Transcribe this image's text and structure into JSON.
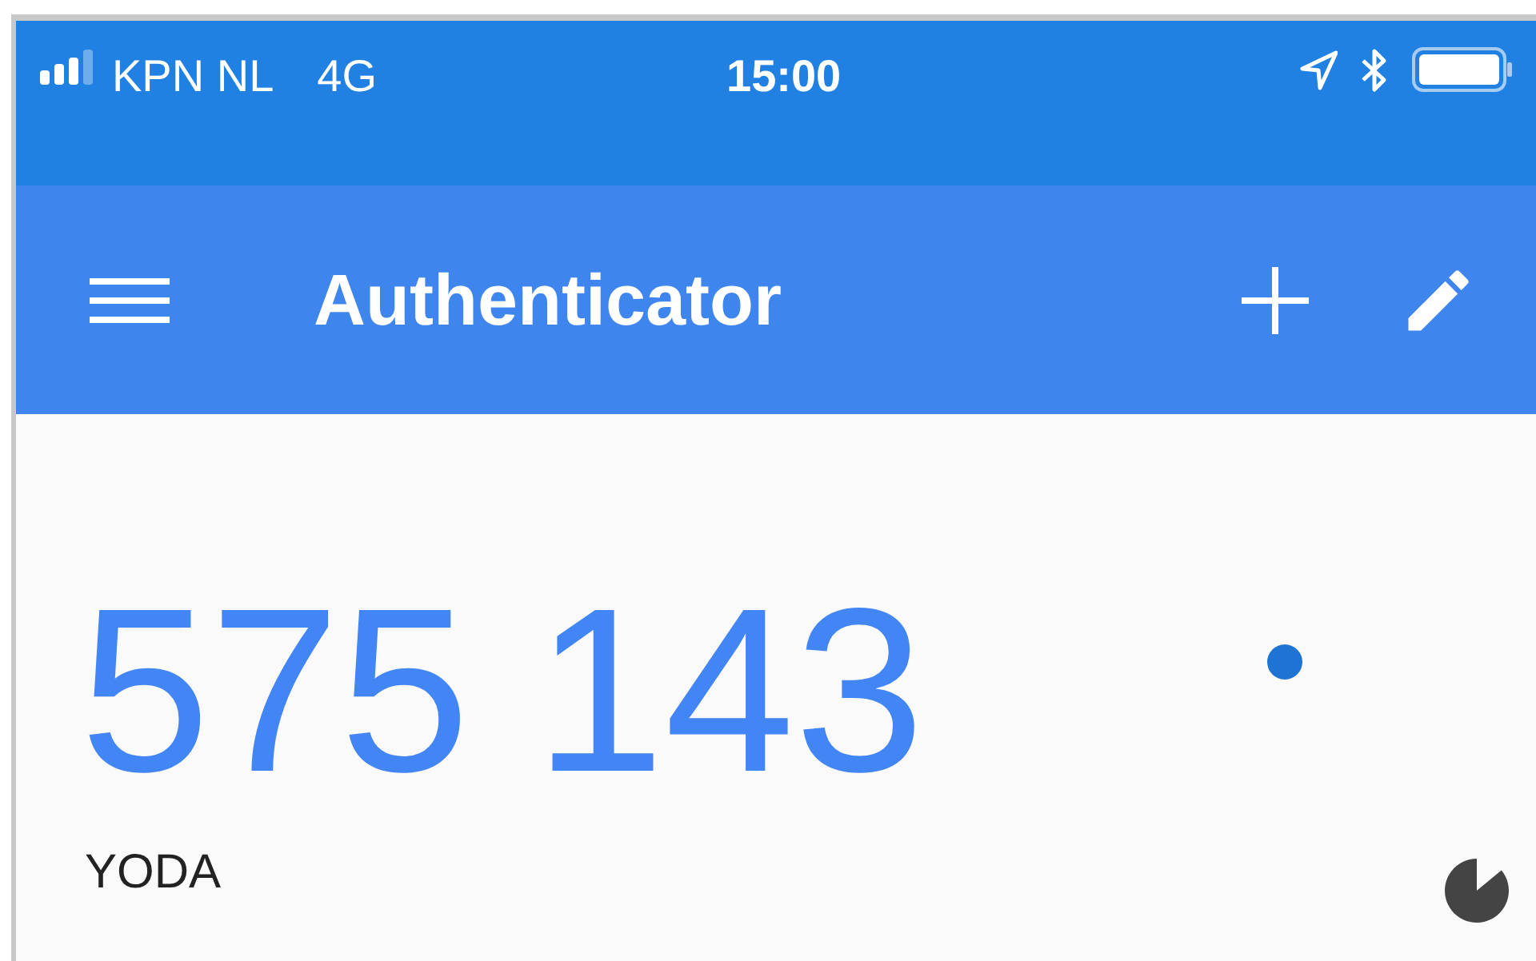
{
  "status_bar": {
    "carrier": "KPN NL",
    "network": "4G",
    "time": "15:00"
  },
  "app_bar": {
    "title": "Authenticator"
  },
  "accounts": [
    {
      "code": "575 143",
      "name": "YODA",
      "selected": true
    }
  ]
}
